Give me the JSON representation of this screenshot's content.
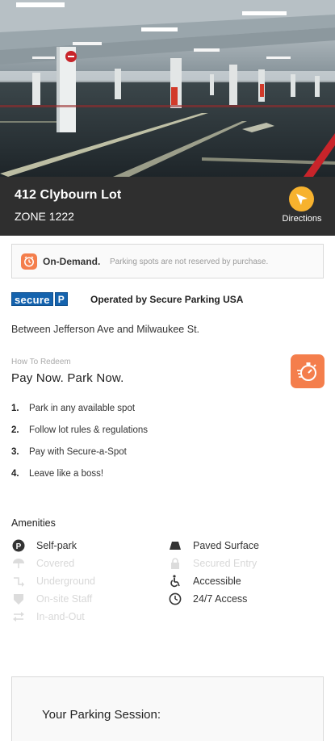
{
  "hero": {
    "description_icon": "parking-garage-photo"
  },
  "lot": {
    "name": "412 Clybourn Lot",
    "zone": "ZONE 1222",
    "directions_label": "Directions",
    "directions_icon": "navigation-arrow-icon"
  },
  "notice": {
    "title": "On-Demand.",
    "text": "Parking spots are not reserved by purchase.",
    "icon": "clock-icon"
  },
  "operator": {
    "logo_text": "secure",
    "logo_badge": "P",
    "label": "Operated by Secure Parking USA"
  },
  "location": {
    "between": "Between Jefferson Ave and Milwaukee St."
  },
  "redeem": {
    "caption": "How To Redeem",
    "title": "Pay Now. Park Now.",
    "icon": "stopwatch-icon",
    "steps": [
      {
        "num": "1.",
        "text": "Park in any available spot"
      },
      {
        "num": "2.",
        "text": "Follow lot rules & regulations"
      },
      {
        "num": "3.",
        "text": "Pay with Secure-a-Spot"
      },
      {
        "num": "4.",
        "text": "Leave like a boss!"
      }
    ]
  },
  "amenities": {
    "title": "Amenities",
    "items": [
      {
        "label": "Self-park",
        "icon": "parking-p-icon",
        "available": true
      },
      {
        "label": "Covered",
        "icon": "umbrella-icon",
        "available": false
      },
      {
        "label": "Underground",
        "icon": "underground-arrow-icon",
        "available": false
      },
      {
        "label": "On-site Staff",
        "icon": "staff-badge-icon",
        "available": false
      },
      {
        "label": "In-and-Out",
        "icon": "in-out-arrows-icon",
        "available": false
      },
      {
        "label": "Paved Surface",
        "icon": "paved-road-icon",
        "available": true
      },
      {
        "label": "Secured Entry",
        "icon": "lock-icon",
        "available": false
      },
      {
        "label": "Accessible",
        "icon": "wheelchair-icon",
        "available": true
      },
      {
        "label": "24/7 Access",
        "icon": "clock-icon",
        "available": true
      }
    ]
  },
  "session": {
    "title": "Your Parking Session:"
  },
  "colors": {
    "band": "#2f2f2f",
    "accent_orange": "#f47e4c",
    "directions_yellow": "#f7b22e",
    "logo_blue": "#1563ae"
  }
}
